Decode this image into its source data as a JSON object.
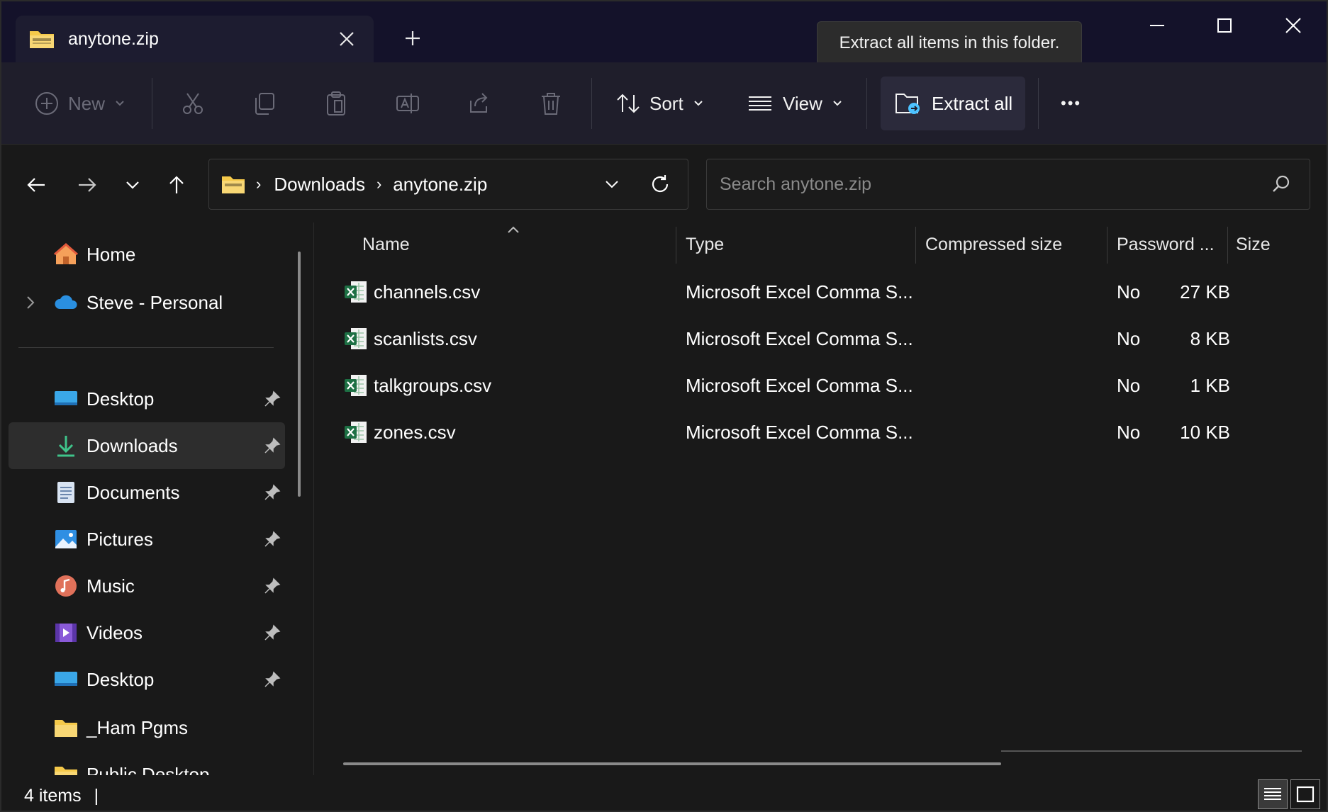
{
  "tab": {
    "title": "anytone.zip",
    "close_icon": "close-icon"
  },
  "new_tab_icon": "plus-icon",
  "tooltip": {
    "text": "Extract all items in this folder."
  },
  "window_controls": {
    "minimize": "minimize-icon",
    "maximize": "maximize-icon",
    "close": "close-icon"
  },
  "toolbar": {
    "new_label": "New",
    "sort_label": "Sort",
    "view_label": "View",
    "extract_label": "Extract all",
    "more_label": "•••"
  },
  "address": {
    "segments": [
      "Downloads",
      "anytone.zip"
    ],
    "separator": "›"
  },
  "search": {
    "placeholder": "Search anytone.zip"
  },
  "sidebar": {
    "home": "Home",
    "personal": "Steve - Personal",
    "pinned": [
      {
        "label": "Desktop",
        "icon": "desktop-icon"
      },
      {
        "label": "Downloads",
        "icon": "download-icon"
      },
      {
        "label": "Documents",
        "icon": "documents-icon"
      },
      {
        "label": "Pictures",
        "icon": "pictures-icon"
      },
      {
        "label": "Music",
        "icon": "music-icon"
      },
      {
        "label": "Videos",
        "icon": "videos-icon"
      },
      {
        "label": "Desktop",
        "icon": "desktop-icon"
      },
      {
        "label": "_Ham Pgms",
        "icon": "folder-icon"
      },
      {
        "label": "Public Desktop",
        "icon": "folder-icon"
      }
    ]
  },
  "columns": [
    "Name",
    "Type",
    "Compressed size",
    "Password ...",
    "Size"
  ],
  "files": [
    {
      "name": "channels.csv",
      "type": "Microsoft Excel Comma S...",
      "compressed": "27 KB",
      "password": "No"
    },
    {
      "name": "scanlists.csv",
      "type": "Microsoft Excel Comma S...",
      "compressed": "8 KB",
      "password": "No"
    },
    {
      "name": "talkgroups.csv",
      "type": "Microsoft Excel Comma S...",
      "compressed": "1 KB",
      "password": "No"
    },
    {
      "name": "zones.csv",
      "type": "Microsoft Excel Comma S...",
      "compressed": "10 KB",
      "password": "No"
    }
  ],
  "status": {
    "items": "4 items",
    "cursor": "|"
  },
  "colors": {
    "accent": "#4cc2ff",
    "folder": "#f5c94a",
    "excel": "#1d7044",
    "titlebar": "#14122a",
    "toolbar": "#1f1e2b"
  }
}
